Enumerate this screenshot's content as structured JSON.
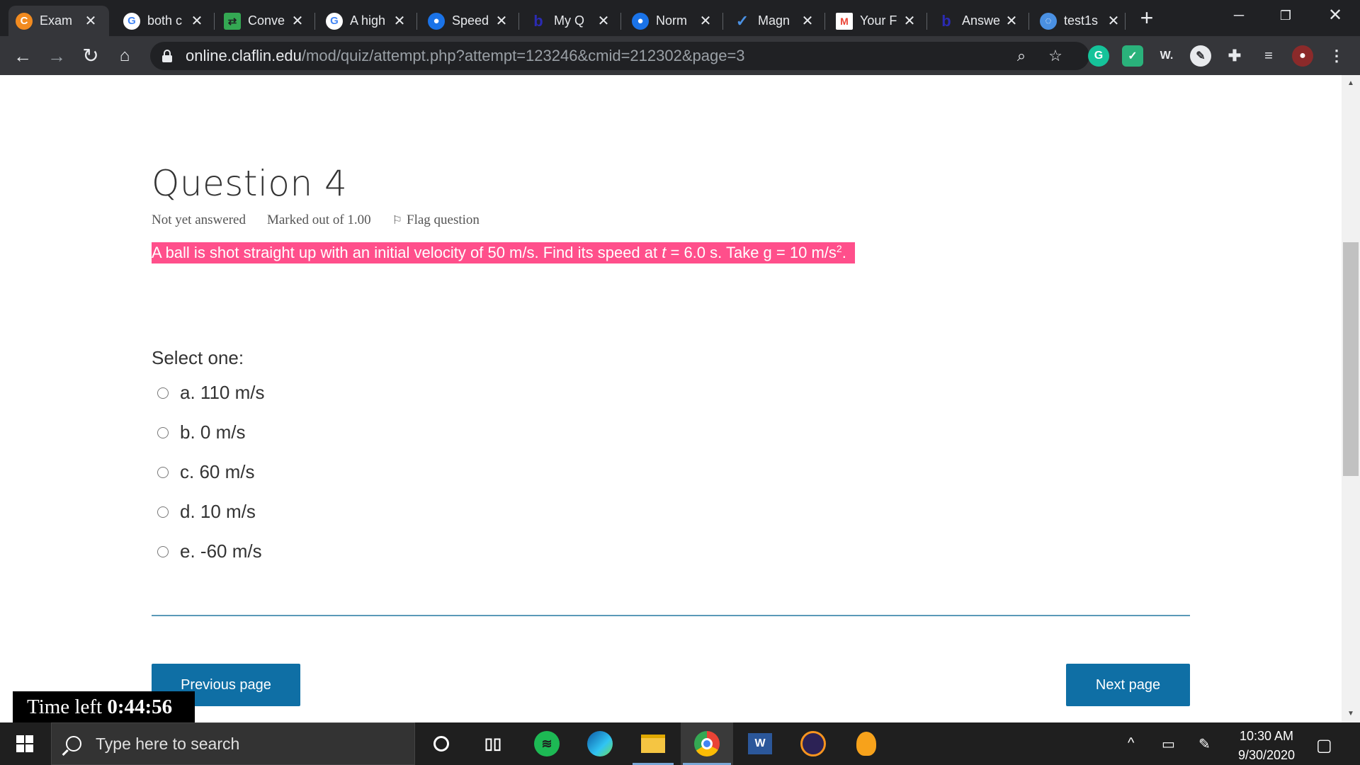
{
  "browser": {
    "tabs": [
      {
        "title": "Exam",
        "icon": "claflin-icon",
        "color": "#f28b20",
        "active": true
      },
      {
        "title": "both c",
        "icon": "google-icon",
        "color": "#ffffff"
      },
      {
        "title": "Conve",
        "icon": "converter-icon",
        "color": "#34a853"
      },
      {
        "title": "A high",
        "icon": "google-icon",
        "color": "#ffffff"
      },
      {
        "title": "Speed",
        "icon": "physics-icon",
        "color": "#1a73e8"
      },
      {
        "title": "My Q",
        "icon": "bartleby-icon",
        "color": "#2b2bb3"
      },
      {
        "title": "Norm",
        "icon": "physics-icon",
        "color": "#1a73e8"
      },
      {
        "title": "Magn",
        "icon": "checkmark-icon",
        "color": "#4a90e2"
      },
      {
        "title": "Your F",
        "icon": "gmail-icon",
        "color": "#ea4335"
      },
      {
        "title": "Answe",
        "icon": "bartleby-icon",
        "color": "#2b2bb3"
      },
      {
        "title": "test1s",
        "icon": "quizlet-icon",
        "color": "#4a90e2"
      }
    ],
    "url_domain": "online.claflin.edu",
    "url_path": "/mod/quiz/attempt.php?attempt=123246&cmid=212302&page=3"
  },
  "question": {
    "title": "Question 4",
    "status": "Not yet answered",
    "marks": "Marked out of 1.00",
    "flag_label": "Flag question",
    "text_before": "A ball is shot straight up with an initial velocity of 50 m/s. Find its speed at ",
    "text_var": "t",
    "text_after": " = 6.0 s. Take g = 10 m/s",
    "text_sup": "2",
    "text_end": ".",
    "select_label": "Select one:",
    "options": [
      {
        "label": "a. 110 m/s"
      },
      {
        "label": "b. 0 m/s"
      },
      {
        "label": "c. 60 m/s"
      },
      {
        "label": "d. 10 m/s"
      },
      {
        "label": "e. -60 m/s"
      }
    ]
  },
  "navigation": {
    "previous_label": "Previous page",
    "next_label": "Next page"
  },
  "timer": {
    "label": "Time left",
    "value": "0:44:56"
  },
  "taskbar": {
    "search_placeholder": "Type here to search",
    "time": "10:30 AM",
    "date": "9/30/2020"
  },
  "colors": {
    "highlight": "#ff4f8b",
    "button": "#0f6fa5",
    "divider": "#5a9ab8"
  }
}
